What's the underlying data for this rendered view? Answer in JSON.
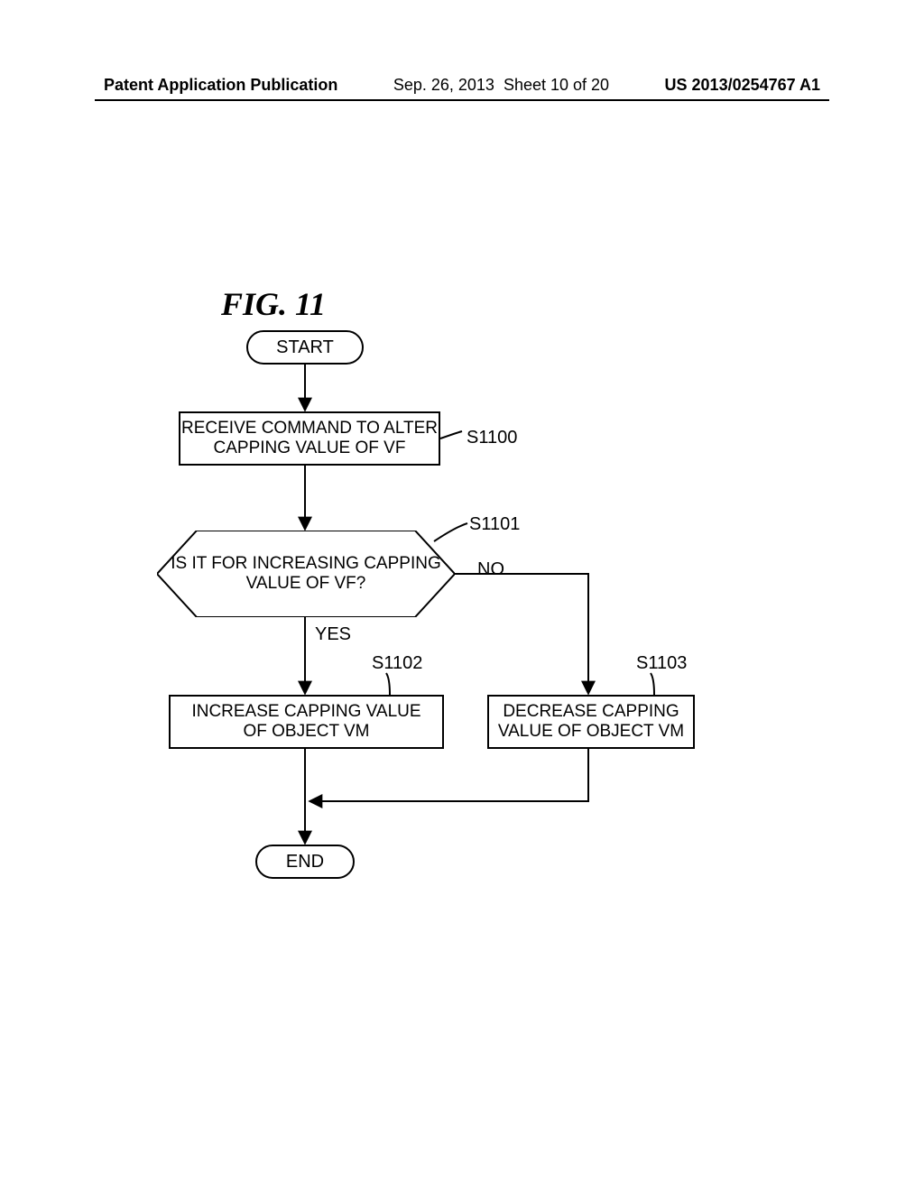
{
  "header": {
    "publication": "Patent Application Publication",
    "date": "Sep. 26, 2013",
    "sheet": "Sheet 10 of 20",
    "pubno": "US 2013/0254767 A1"
  },
  "figure": {
    "title": "FIG.  11"
  },
  "nodes": {
    "start": "START",
    "end": "END",
    "p1100": "RECEIVE COMMAND TO ALTER\nCAPPING VALUE OF VF",
    "decision": "IS IT FOR INCREASING CAPPING\nVALUE OF VF?",
    "p1102": "INCREASE CAPPING VALUE\nOF OBJECT VM",
    "p1103": "DECREASE CAPPING\nVALUE OF OBJECT VM"
  },
  "labels": {
    "s1100": "S1100",
    "s1101": "S1101",
    "s1102": "S1102",
    "s1103": "S1103",
    "yes": "YES",
    "no": "NO"
  }
}
